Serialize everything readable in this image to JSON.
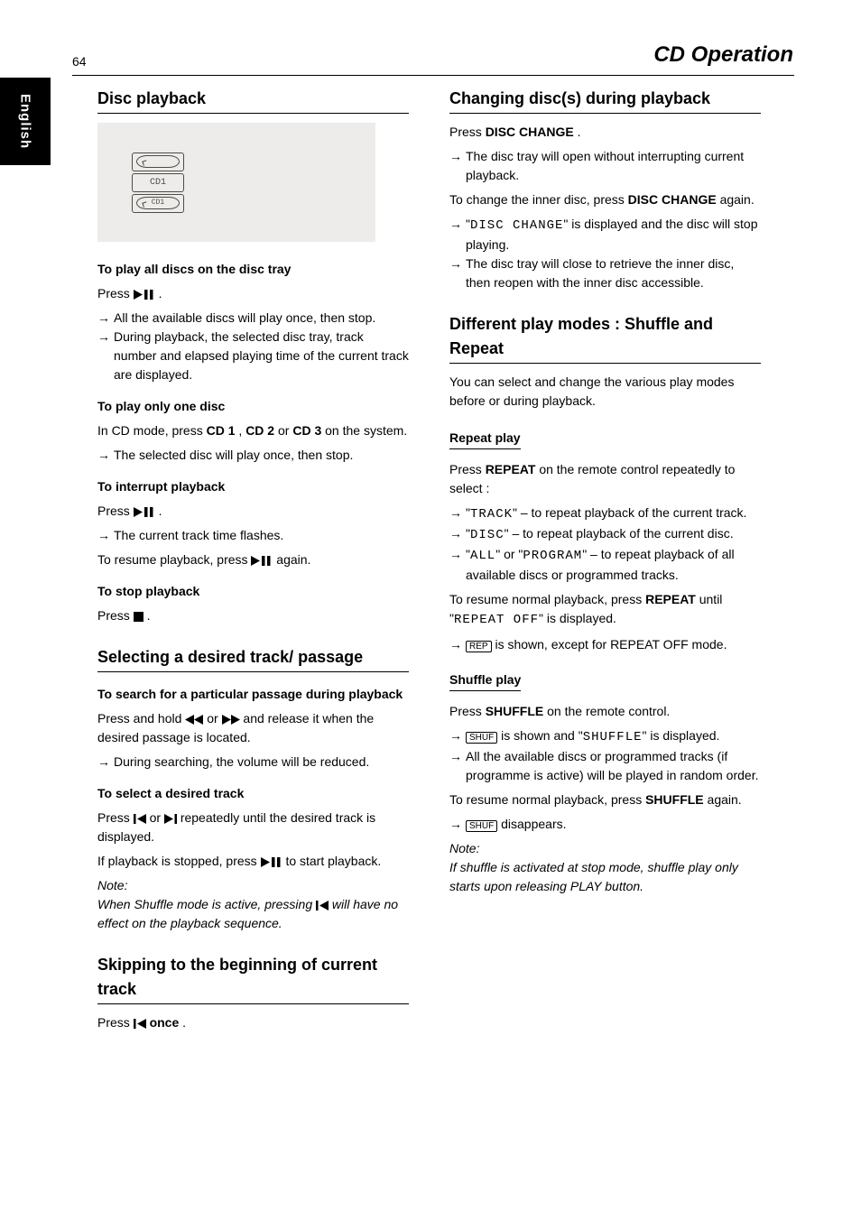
{
  "tab": "English",
  "page_number": "64",
  "page_title": "CD Operation",
  "display_label": "CD1",
  "col1": {
    "h_disc_playback": "Disc playback",
    "p_play_all": "To play all discs on the disc tray",
    "press1_a": "Press ",
    "press1_b": " .",
    "bullet1": "All the available discs will play once, then stop.",
    "bullet2_a": "During playback, the selected disc tray, track number and elapsed playing time of the current track are displayed.",
    "p_play_one": "To play only one disc",
    "p_cdmode_a": "In CD mode, press ",
    "p_cdmode_cd1": "CD 1",
    "p_cdmode_comma": ", ",
    "p_cdmode_cd2": "CD 2",
    "p_cdmode_or": " or ",
    "p_cdmode_cd3": "CD 3",
    "p_cdmode_b": " on the system.",
    "bullet3": "The selected disc will play once, then stop.",
    "p_interrupt": "To interrupt playback",
    "press2_a": "Press ",
    "press2_b": ".",
    "bullet4": "The current track time flashes.",
    "resume1_a": "To resume playback, press ",
    "resume1_b": " again.",
    "p_stop": "To stop playback",
    "press3_a": "Press ",
    "press3_b": " .",
    "h_select": "Selecting a desired track/ passage",
    "p_search": "To search for a particular passage during playback",
    "p_search_body_a": "Press and hold ",
    "p_search_body_b": " or ",
    "p_search_body_c": " and release it when the desired passage is located.",
    "bullet5": "During searching, the volume will be reduced.",
    "p_seltrack": "To select a desired track",
    "p_seltrack_body_a": "Press ",
    "p_seltrack_body_b": " or ",
    "p_seltrack_body_c": " repeatedly until the desired track is displayed.",
    "p_ifstopped_a": "If playback is stopped, press ",
    "p_ifstopped_b": " to start playback.",
    "note": "Note:",
    "note_body_a": "When Shuffle mode is active, pressing ",
    "note_body_b": " will have no effect on the playback sequence.",
    "h_skipcurrent": "Skipping to the beginning of current track",
    "press4_a": "Press ",
    "press4_once": " once",
    "press4_b": "."
  },
  "col2": {
    "h_changedisc": "Changing disc(s) during playback",
    "press5_a": "Press ",
    "press5_bold": "DISC CHANGE",
    "press5_b": ".",
    "bullet6": "The disc tray will open without interrupting current playback.",
    "p_changeinner_a": "To change the inner disc, press ",
    "p_changeinner_bold": "DISC CHANGE",
    "p_changeinner_b": " again.",
    "bullet7_a": "\"",
    "bullet7_lcd": "DISC CHANGE",
    "bullet7_b": "\" is displayed and the disc will stop playing.",
    "bullet8": "The disc tray will close to retrieve the inner disc, then reopen with the inner disc accessible.",
    "h_playmode": "Different play modes : Shuffle and Repeat",
    "p_playmode_intro": "You can select and change the various play modes before or during playback.",
    "h_repeat": "Repeat play",
    "press6_a": "Press ",
    "press6_bold": "REPEAT",
    "press6_b": " on the remote control repeatedly to select :",
    "rep_track_a": "\"",
    "rep_track_lcd": "TRACK",
    "rep_track_b": "\"  – to repeat playback of the current track.",
    "rep_disc_a": "\"",
    "rep_disc_lcd": "DISC",
    "rep_disc_b": "\"  – to repeat playback of the current disc.",
    "rep_all_a": "\"",
    "rep_all_lcd1": "ALL",
    "rep_all_or": "\" or \"",
    "rep_all_lcd2": "PROGRAM",
    "rep_all_b": "\"  – to repeat playback of all available discs or programmed tracks.",
    "resume2_a": "To resume normal playback, press ",
    "resume2_bold": "REPEAT",
    "resume2_b": " until \"",
    "resume2_lcd": "REPEAT OFF",
    "resume2_c": "\" is displayed.",
    "bullet9_a": "REP",
    "bullet9_b": " is shown, except for REPEAT OFF mode.",
    "h_shuffle": "Shuffle play",
    "press7_a": "Press ",
    "press7_bold": "SHUFFLE",
    "press7_b": " on the remote control.",
    "bullet10_a": "SHUF",
    "bullet10_b": " is shown and \"",
    "bullet10_lcd": "SHUFFLE",
    "bullet10_c": "\" is displayed.",
    "bullet11": "All the available discs or programmed tracks (if programme is active) will be played in random order.",
    "resume3_a": "To resume normal playback, press ",
    "resume3_bold": "SHUFFLE",
    "resume3_b": " again.",
    "bullet12_a": "SHUF",
    "bullet12_b": " disappears.",
    "note2": "Note:",
    "note2_body": "If shuffle is activated at stop mode, shuffle play only starts upon releasing PLAY button."
  }
}
